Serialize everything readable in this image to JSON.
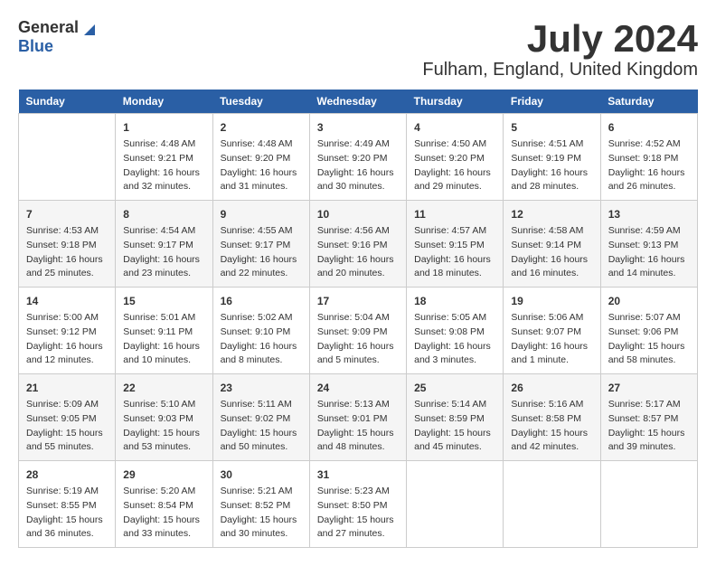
{
  "header": {
    "logo_general": "General",
    "logo_blue": "Blue",
    "month": "July 2024",
    "location": "Fulham, England, United Kingdom"
  },
  "days_of_week": [
    "Sunday",
    "Monday",
    "Tuesday",
    "Wednesday",
    "Thursday",
    "Friday",
    "Saturday"
  ],
  "weeks": [
    [
      {
        "day": "",
        "content": ""
      },
      {
        "day": "1",
        "content": "Sunrise: 4:48 AM\nSunset: 9:21 PM\nDaylight: 16 hours\nand 32 minutes."
      },
      {
        "day": "2",
        "content": "Sunrise: 4:48 AM\nSunset: 9:20 PM\nDaylight: 16 hours\nand 31 minutes."
      },
      {
        "day": "3",
        "content": "Sunrise: 4:49 AM\nSunset: 9:20 PM\nDaylight: 16 hours\nand 30 minutes."
      },
      {
        "day": "4",
        "content": "Sunrise: 4:50 AM\nSunset: 9:20 PM\nDaylight: 16 hours\nand 29 minutes."
      },
      {
        "day": "5",
        "content": "Sunrise: 4:51 AM\nSunset: 9:19 PM\nDaylight: 16 hours\nand 28 minutes."
      },
      {
        "day": "6",
        "content": "Sunrise: 4:52 AM\nSunset: 9:18 PM\nDaylight: 16 hours\nand 26 minutes."
      }
    ],
    [
      {
        "day": "7",
        "content": "Sunrise: 4:53 AM\nSunset: 9:18 PM\nDaylight: 16 hours\nand 25 minutes."
      },
      {
        "day": "8",
        "content": "Sunrise: 4:54 AM\nSunset: 9:17 PM\nDaylight: 16 hours\nand 23 minutes."
      },
      {
        "day": "9",
        "content": "Sunrise: 4:55 AM\nSunset: 9:17 PM\nDaylight: 16 hours\nand 22 minutes."
      },
      {
        "day": "10",
        "content": "Sunrise: 4:56 AM\nSunset: 9:16 PM\nDaylight: 16 hours\nand 20 minutes."
      },
      {
        "day": "11",
        "content": "Sunrise: 4:57 AM\nSunset: 9:15 PM\nDaylight: 16 hours\nand 18 minutes."
      },
      {
        "day": "12",
        "content": "Sunrise: 4:58 AM\nSunset: 9:14 PM\nDaylight: 16 hours\nand 16 minutes."
      },
      {
        "day": "13",
        "content": "Sunrise: 4:59 AM\nSunset: 9:13 PM\nDaylight: 16 hours\nand 14 minutes."
      }
    ],
    [
      {
        "day": "14",
        "content": "Sunrise: 5:00 AM\nSunset: 9:12 PM\nDaylight: 16 hours\nand 12 minutes."
      },
      {
        "day": "15",
        "content": "Sunrise: 5:01 AM\nSunset: 9:11 PM\nDaylight: 16 hours\nand 10 minutes."
      },
      {
        "day": "16",
        "content": "Sunrise: 5:02 AM\nSunset: 9:10 PM\nDaylight: 16 hours\nand 8 minutes."
      },
      {
        "day": "17",
        "content": "Sunrise: 5:04 AM\nSunset: 9:09 PM\nDaylight: 16 hours\nand 5 minutes."
      },
      {
        "day": "18",
        "content": "Sunrise: 5:05 AM\nSunset: 9:08 PM\nDaylight: 16 hours\nand 3 minutes."
      },
      {
        "day": "19",
        "content": "Sunrise: 5:06 AM\nSunset: 9:07 PM\nDaylight: 16 hours\nand 1 minute."
      },
      {
        "day": "20",
        "content": "Sunrise: 5:07 AM\nSunset: 9:06 PM\nDaylight: 15 hours\nand 58 minutes."
      }
    ],
    [
      {
        "day": "21",
        "content": "Sunrise: 5:09 AM\nSunset: 9:05 PM\nDaylight: 15 hours\nand 55 minutes."
      },
      {
        "day": "22",
        "content": "Sunrise: 5:10 AM\nSunset: 9:03 PM\nDaylight: 15 hours\nand 53 minutes."
      },
      {
        "day": "23",
        "content": "Sunrise: 5:11 AM\nSunset: 9:02 PM\nDaylight: 15 hours\nand 50 minutes."
      },
      {
        "day": "24",
        "content": "Sunrise: 5:13 AM\nSunset: 9:01 PM\nDaylight: 15 hours\nand 48 minutes."
      },
      {
        "day": "25",
        "content": "Sunrise: 5:14 AM\nSunset: 8:59 PM\nDaylight: 15 hours\nand 45 minutes."
      },
      {
        "day": "26",
        "content": "Sunrise: 5:16 AM\nSunset: 8:58 PM\nDaylight: 15 hours\nand 42 minutes."
      },
      {
        "day": "27",
        "content": "Sunrise: 5:17 AM\nSunset: 8:57 PM\nDaylight: 15 hours\nand 39 minutes."
      }
    ],
    [
      {
        "day": "28",
        "content": "Sunrise: 5:19 AM\nSunset: 8:55 PM\nDaylight: 15 hours\nand 36 minutes."
      },
      {
        "day": "29",
        "content": "Sunrise: 5:20 AM\nSunset: 8:54 PM\nDaylight: 15 hours\nand 33 minutes."
      },
      {
        "day": "30",
        "content": "Sunrise: 5:21 AM\nSunset: 8:52 PM\nDaylight: 15 hours\nand 30 minutes."
      },
      {
        "day": "31",
        "content": "Sunrise: 5:23 AM\nSunset: 8:50 PM\nDaylight: 15 hours\nand 27 minutes."
      },
      {
        "day": "",
        "content": ""
      },
      {
        "day": "",
        "content": ""
      },
      {
        "day": "",
        "content": ""
      }
    ]
  ]
}
